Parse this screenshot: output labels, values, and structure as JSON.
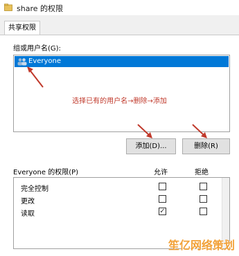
{
  "window": {
    "title": "share 的权限"
  },
  "tabs": [
    {
      "label": "共享权限"
    }
  ],
  "groups": {
    "label": "组或用户名(G):",
    "items": [
      {
        "name": "Everyone",
        "selected": true
      }
    ]
  },
  "annotation": {
    "text": "选择已有的用户名→删除→添加",
    "color": "#c0392b"
  },
  "buttons": {
    "add_label": "添加(D)...",
    "remove_label": "删除(R)"
  },
  "permissions": {
    "title": "Everyone 的权限(P)",
    "allow_header": "允许",
    "deny_header": "拒绝",
    "rows": [
      {
        "name": "完全控制",
        "allow": false,
        "deny": false
      },
      {
        "name": "更改",
        "allow": false,
        "deny": false
      },
      {
        "name": "读取",
        "allow": true,
        "deny": false
      }
    ]
  },
  "watermark": {
    "text": "笙亿网络策划"
  },
  "colors": {
    "selection": "#0078d7",
    "annotation_arrow": "#c0392b",
    "watermark": "#f2a23a"
  },
  "icons": {
    "title": "folder-icon",
    "group": "users-icon"
  }
}
